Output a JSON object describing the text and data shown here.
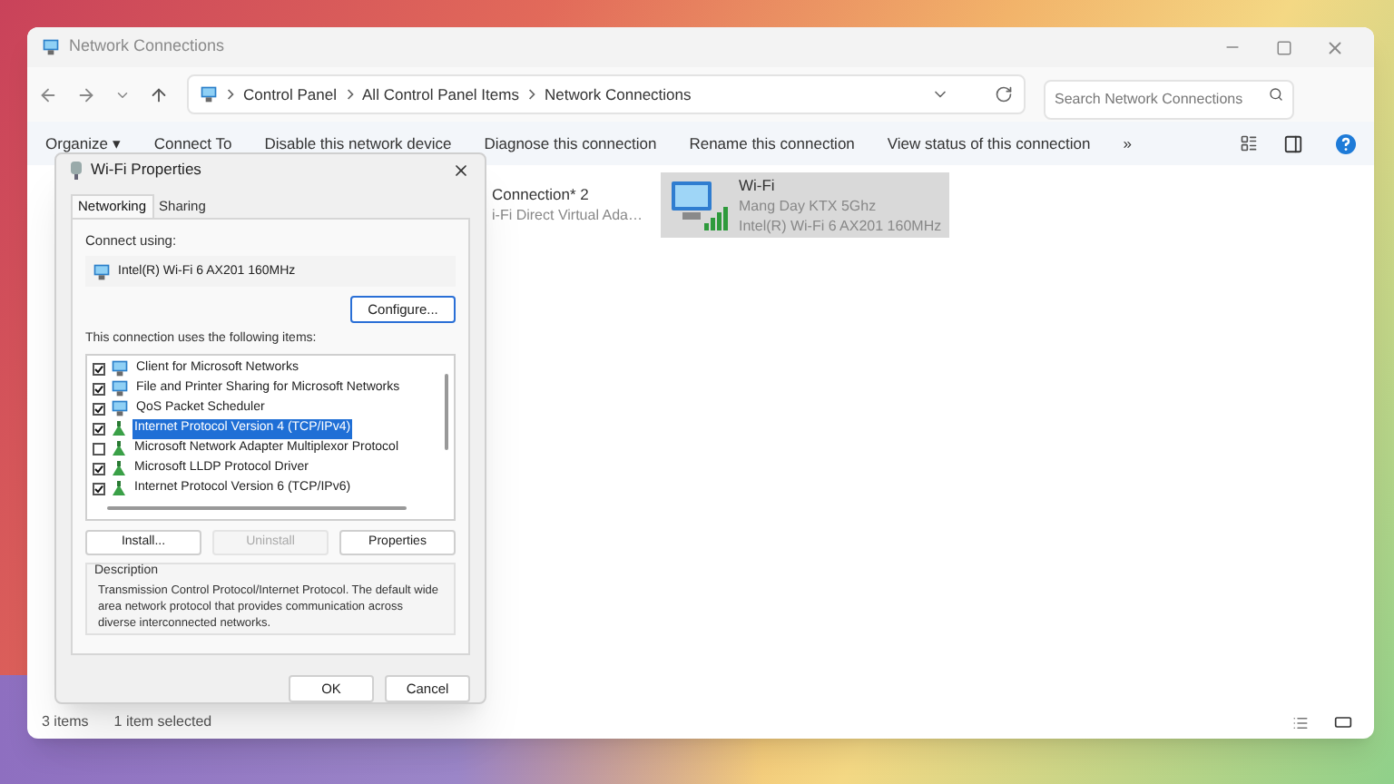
{
  "window": {
    "title": "Network Connections"
  },
  "address": {
    "breadcrumb": [
      "Control Panel",
      "All Control Panel Items",
      "Network Connections"
    ]
  },
  "search": {
    "placeholder": "Search Network Connections"
  },
  "command_bar": [
    "Organize ▾",
    "Connect To",
    "Disable this network device",
    "Diagnose this connection",
    "Rename this connection",
    "View status of this connection",
    "»"
  ],
  "connections": [
    {
      "kind": "wifi-direct",
      "name": "Connection* 2",
      "device": "i-Fi Direct Virtual Ada…",
      "selected": false
    },
    {
      "kind": "wifi",
      "name": "Wi-Fi",
      "status": "Mang Day KTX 5Ghz",
      "device": "Intel(R) Wi-Fi 6 AX201 160MHz",
      "selected": true
    }
  ],
  "status_bar": {
    "count": "3 items",
    "selection": "1 item selected"
  },
  "dialog": {
    "title": "Wi-Fi Properties",
    "tabs": [
      {
        "label": "Networking",
        "selected": true
      },
      {
        "label": "Sharing",
        "selected": false
      }
    ],
    "connect_using_label": "Connect using:",
    "adapter": "Intel(R) Wi-Fi 6 AX201 160MHz",
    "configure_button": "Configure...",
    "items_label": "This connection uses the following items:",
    "items": [
      {
        "kind": "client",
        "label": "Client for Microsoft Networks",
        "checked": true,
        "selected": false
      },
      {
        "kind": "service",
        "label": "File and Printer Sharing for Microsoft Networks",
        "checked": true,
        "selected": false
      },
      {
        "kind": "service",
        "label": "QoS Packet Scheduler",
        "checked": true,
        "selected": false
      },
      {
        "kind": "protocol",
        "label": "Internet Protocol Version 4 (TCP/IPv4)",
        "checked": true,
        "selected": true
      },
      {
        "kind": "protocol",
        "label": "Microsoft Network Adapter Multiplexor Protocol",
        "checked": false,
        "selected": false
      },
      {
        "kind": "protocol",
        "label": "Microsoft LLDP Protocol Driver",
        "checked": true,
        "selected": false
      },
      {
        "kind": "protocol",
        "label": "Internet Protocol Version 6 (TCP/IPv6)",
        "checked": true,
        "selected": false
      }
    ],
    "buttons": [
      {
        "label": "Install...",
        "disabled": false
      },
      {
        "label": "Uninstall",
        "disabled": true
      },
      {
        "label": "Properties",
        "disabled": false
      }
    ],
    "description": {
      "title": "Description",
      "text": "Transmission Control Protocol/Internet Protocol. The default wide area network protocol that provides communication across diverse interconnected networks."
    },
    "footer_buttons": [
      "OK",
      "Cancel"
    ]
  }
}
